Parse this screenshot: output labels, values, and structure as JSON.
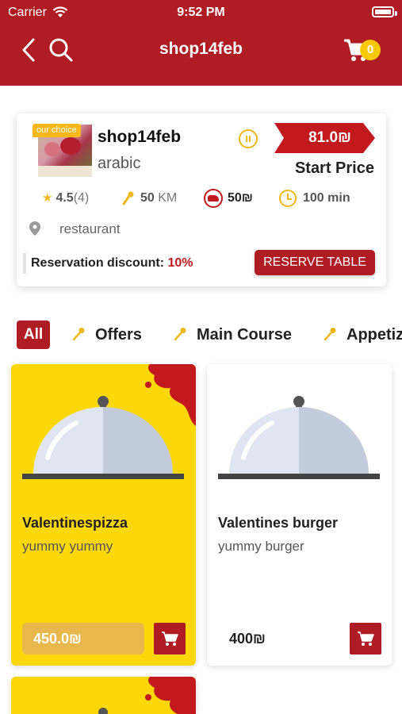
{
  "status_bar": {
    "carrier": "Carrier",
    "time": "9:52 PM"
  },
  "header": {
    "title": "shop14feb",
    "cart_count": "0"
  },
  "shop": {
    "badge": "our choice",
    "name": "shop14feb",
    "cuisine": "arabic",
    "price": "81.0₪",
    "price_caption": "Start Price",
    "rating": "4.5",
    "rating_count": "(4)",
    "distance_value": "50",
    "distance_unit": "KM",
    "delivery_fee": "50₪",
    "time_value": "100",
    "time_unit": "min",
    "location": "restaurant",
    "discount_label": "Reservation discount:",
    "discount_value": "10%",
    "reserve_label": "RESERVE TABLE"
  },
  "tabs": [
    {
      "label": "All"
    },
    {
      "label": "Offers"
    },
    {
      "label": "Main Course"
    },
    {
      "label": "Appetizers"
    }
  ],
  "products": [
    {
      "name": "Valentinespizza",
      "description": "yummy yummy",
      "price": "450.0₪"
    },
    {
      "name": "Valentines burger",
      "description": "yummy burger",
      "price": "400₪"
    }
  ],
  "colors": {
    "brand_red": "#b01c24",
    "accent_yellow": "#fcd80a",
    "gold": "#f0b71c"
  }
}
